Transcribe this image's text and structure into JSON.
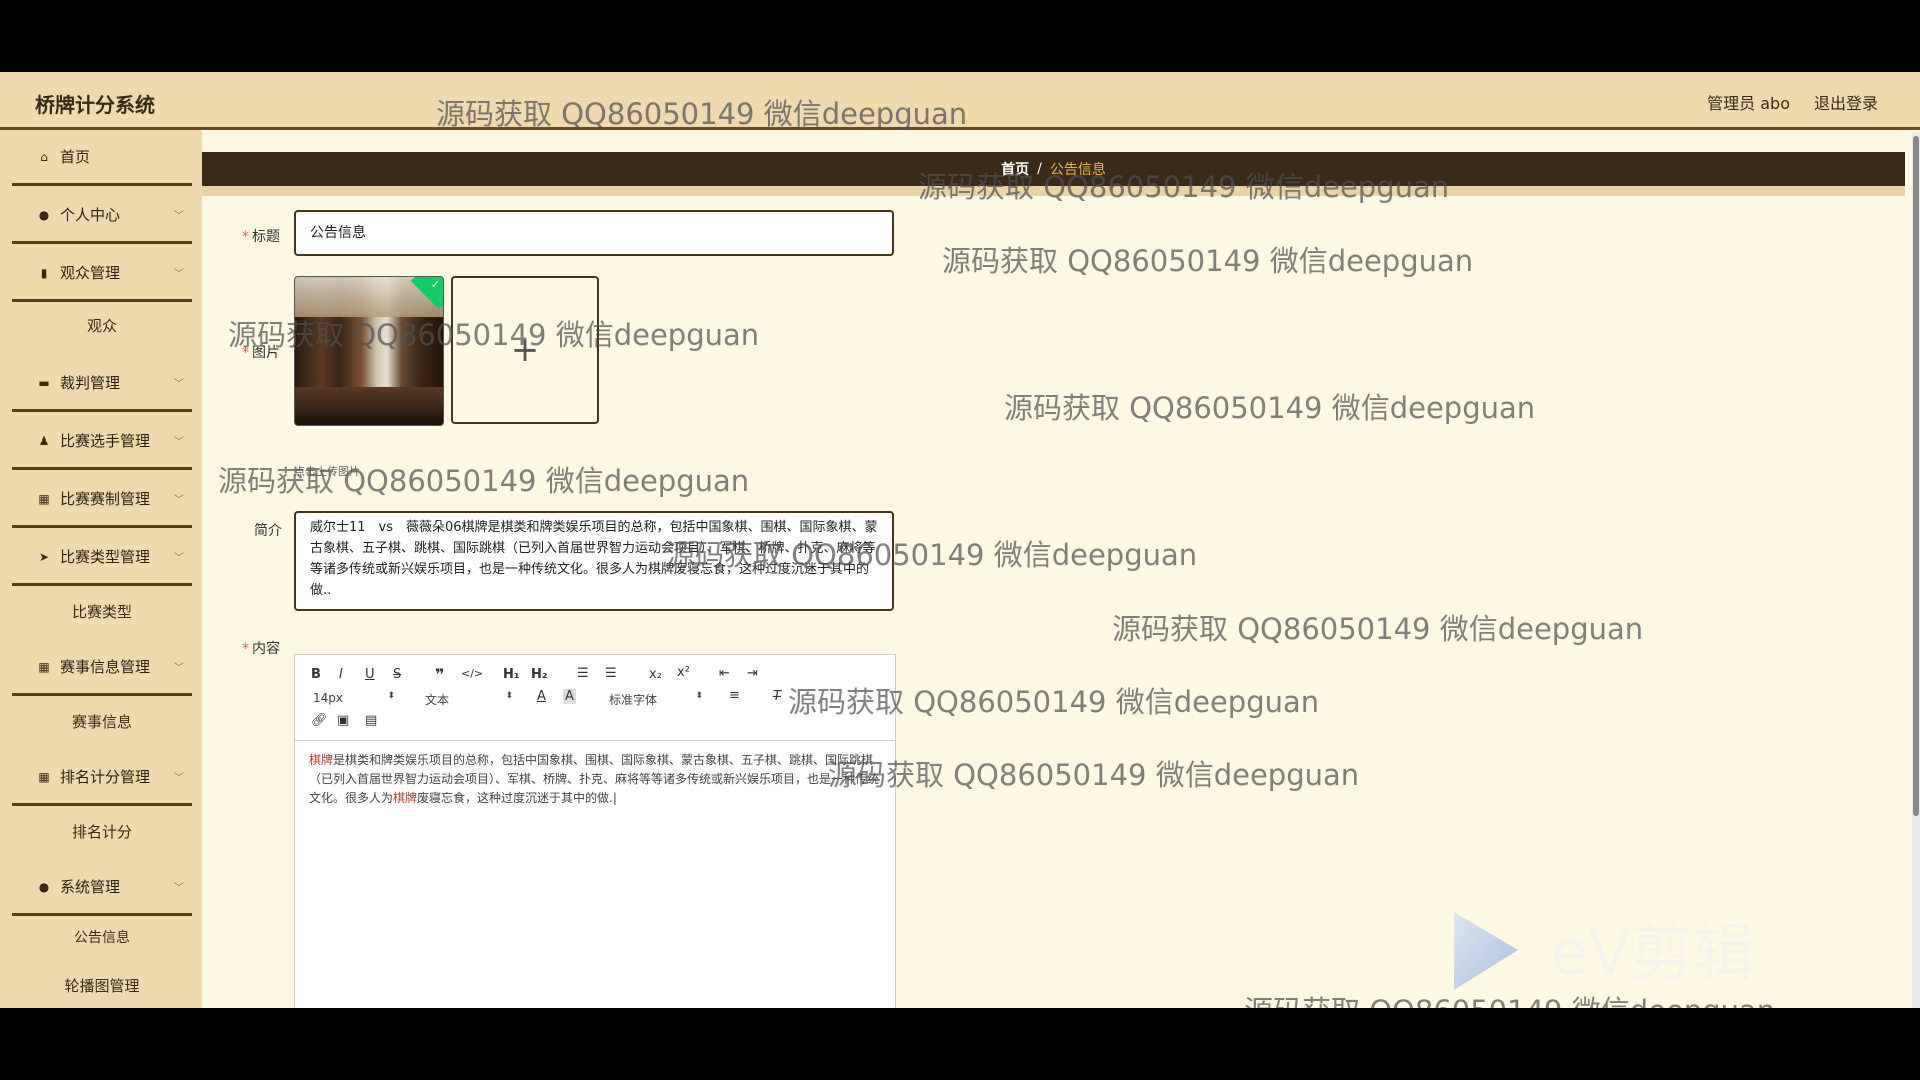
{
  "header": {
    "app_title": "桥牌计分系统",
    "admin_label": "管理员 abo",
    "logout_label": "退出登录"
  },
  "sidebar": {
    "menus": [
      {
        "label": "首页"
      },
      {
        "label": "个人中心"
      },
      {
        "label": "观众管理"
      },
      {
        "label": "裁判管理"
      },
      {
        "label": "比赛选手管理"
      },
      {
        "label": "比赛赛制管理"
      },
      {
        "label": "比赛类型管理"
      },
      {
        "label": "赛事信息管理"
      },
      {
        "label": "排名计分管理"
      },
      {
        "label": "系统管理"
      }
    ],
    "subs": [
      {
        "label": "观众"
      },
      {
        "label": "比赛类型"
      },
      {
        "label": "赛事信息"
      },
      {
        "label": "排名计分"
      },
      {
        "label": "公告信息"
      },
      {
        "label": "轮播图管理"
      }
    ]
  },
  "breadcrumb": {
    "home": "首页",
    "separator": "/",
    "current": "公告信息"
  },
  "form": {
    "title_label": "标题",
    "title_value": "公告信息",
    "image_label": "图片",
    "upload_hint": "点击上传图片",
    "intro_label": "简介",
    "intro_value": "威尔士11　vs　薇薇朵06棋牌是棋类和牌类娱乐项目的总称，包括中国象棋、围棋、国际象棋、蒙古象棋、五子棋、跳棋、国际跳棋（已列入首届世界智力运动会项目）、军棋、桥牌、扑克、麻将等等诸多传统或新兴娱乐项目，也是一种传统文化。很多人为棋牌废寝忘食，这种过度沉迷于其中的做..",
    "content_label": "内容"
  },
  "editor": {
    "font_size": "14px",
    "text_style": "文本",
    "font_family": "标准字体",
    "content_hl1": "棋牌",
    "content_part1": "是棋类和牌类娱乐项目的总称，包括中国象棋、围棋、国际象棋、蒙古象棋、五子棋、跳棋、国际跳棋（已列入首届世界智力运动会项目）、军棋、桥牌、扑克、麻将等等诸多传统或新兴娱乐项目，也是一种传统文化。很多人为",
    "content_hl2": "棋牌",
    "content_part2": "废寝忘食，这种过度沉迷于其中的做."
  },
  "watermark": {
    "text": "源码获取 QQ86050149 微信deepguan",
    "logo_text": "eV剪辑"
  },
  "colors": {
    "header_bg": "#f0d9ad",
    "sidebar_bg": "#f0d9ad",
    "content_bg": "#fdf8e1",
    "crumb_bg": "#3b2a18",
    "accent": "#e7b54f",
    "divider": "#5a3d1c"
  }
}
